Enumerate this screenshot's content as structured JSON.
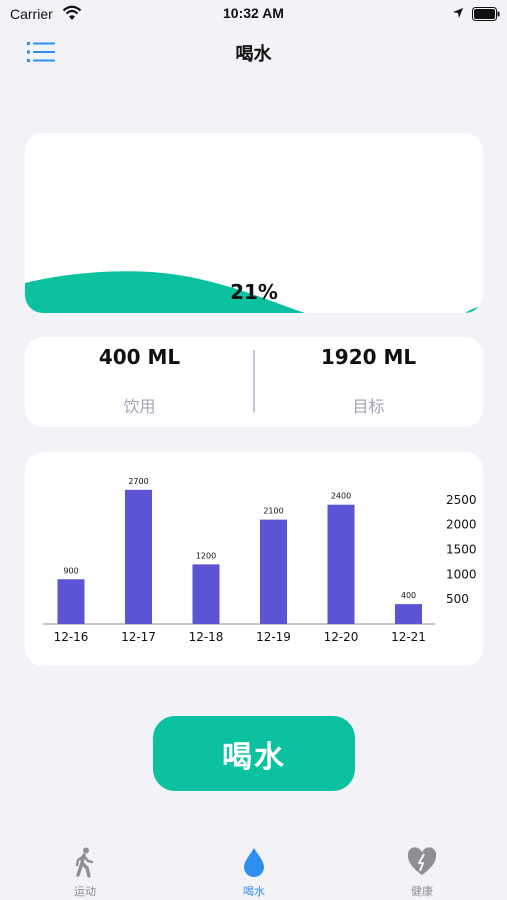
{
  "status_bar": {
    "carrier": "Carrier",
    "time": "10:32 AM"
  },
  "nav": {
    "title": "喝水",
    "menu_icon": "list-icon"
  },
  "progress": {
    "percent_text": "21%",
    "fraction": 0.21,
    "wave_color": "#0cc19f"
  },
  "stats": {
    "drunk": {
      "value": "400 ML",
      "label": "饮用"
    },
    "goal": {
      "value": "1920 ML",
      "label": "目标"
    }
  },
  "chart_data": {
    "type": "bar",
    "categories": [
      "12-16",
      "12-17",
      "12-18",
      "12-19",
      "12-20",
      "12-21"
    ],
    "values": [
      900,
      2700,
      1200,
      2100,
      2400,
      400
    ],
    "data_labels": [
      "900",
      "2700",
      "1200",
      "2100",
      "2400",
      "400"
    ],
    "y_ticks": [
      500,
      1000,
      1500,
      2000,
      2500
    ],
    "y_axis_position": "right",
    "ylim": [
      0,
      2800
    ],
    "bar_color": "#5b55d6",
    "grid": false
  },
  "button": {
    "label": "喝水",
    "color": "#0cc19f"
  },
  "tabs": [
    {
      "label": "运动",
      "icon": "walking-icon",
      "active": false
    },
    {
      "label": "喝水",
      "icon": "water-drop-icon",
      "active": true
    },
    {
      "label": "健康",
      "icon": "heart-pulse-icon",
      "active": false
    }
  ],
  "colors": {
    "accent": "#2f8ff0",
    "inactive": "#8e8e93",
    "background": "#f2f2f7"
  }
}
